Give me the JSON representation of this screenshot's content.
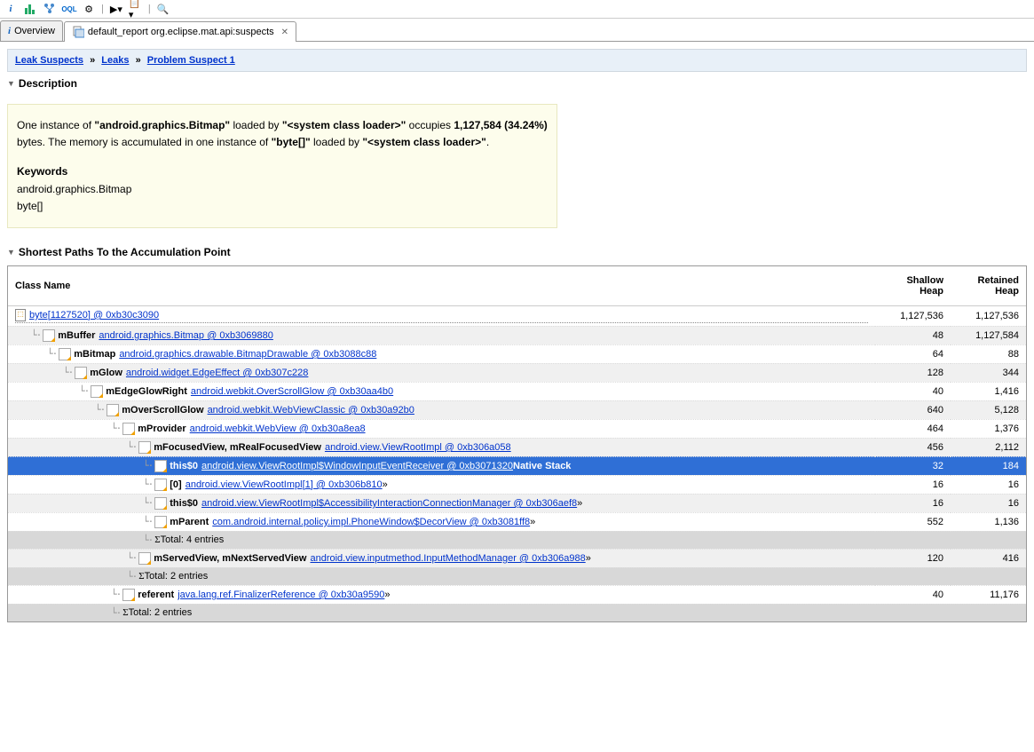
{
  "tabs": {
    "overview": "Overview",
    "report": "default_report  org.eclipse.mat.api:suspects"
  },
  "breadcrumb": {
    "a": "Leak Suspects",
    "b": "Leaks",
    "c": "Problem Suspect 1"
  },
  "sections": {
    "desc_title": "Description",
    "paths_title": "Shortest Paths To the Accumulation Point"
  },
  "desc": {
    "p1a": "One instance of ",
    "p1b": "\"android.graphics.Bitmap\"",
    "p1c": " loaded by ",
    "p1d": "\"<system class loader>\"",
    "p2a": "occupies ",
    "p2b": "1,127,584 (34.24%)",
    "p2c": " bytes. The memory is accumulated in one instance of ",
    "p3a": "\"byte[]\"",
    "p3b": " loaded by ",
    "p3c": "\"<system class loader>\"",
    "p3d": ".",
    "kw_title": "Keywords",
    "kw1": "android.graphics.Bitmap",
    "kw2": "byte[]"
  },
  "table": {
    "h_class": "Class Name",
    "h_shallow": "Shallow Heap",
    "h_retained": "Retained Heap"
  },
  "rows": {
    "r0": {
      "depth": 0,
      "field": "",
      "link": "byte[1127520] @ 0xb30c3090",
      "tail": "",
      "shallow": "1,127,536",
      "retained": "1,127,536",
      "root": true
    },
    "r1": {
      "depth": 1,
      "field": "mBuffer",
      "link": "android.graphics.Bitmap @ 0xb3069880",
      "tail": "",
      "shallow": "48",
      "retained": "1,127,584"
    },
    "r2": {
      "depth": 2,
      "field": "mBitmap",
      "link": "android.graphics.drawable.BitmapDrawable @ 0xb3088c88",
      "tail": "",
      "shallow": "64",
      "retained": "88"
    },
    "r3": {
      "depth": 3,
      "field": "mGlow",
      "link": "android.widget.EdgeEffect @ 0xb307c228",
      "tail": "",
      "shallow": "128",
      "retained": "344"
    },
    "r4": {
      "depth": 4,
      "field": "mEdgeGlowRight",
      "link": "android.webkit.OverScrollGlow @ 0xb30aa4b0",
      "tail": "",
      "shallow": "40",
      "retained": "1,416"
    },
    "r5": {
      "depth": 5,
      "field": "mOverScrollGlow",
      "link": "android.webkit.WebViewClassic @ 0xb30a92b0",
      "tail": "",
      "shallow": "640",
      "retained": "5,128"
    },
    "r6": {
      "depth": 6,
      "field": "mProvider",
      "link": "android.webkit.WebView @ 0xb30a8ea8",
      "tail": "",
      "shallow": "464",
      "retained": "1,376"
    },
    "r7": {
      "depth": 7,
      "field": "mFocusedView, mRealFocusedView",
      "link": "android.view.ViewRootImpl @ 0xb306a058",
      "tail": "",
      "shallow": "456",
      "retained": "2,112"
    },
    "r8": {
      "depth": 8,
      "field": "this$0",
      "link": "android.view.ViewRootImpl$WindowInputEventReceiver @ 0xb3071320",
      "tail": " Native Stack",
      "shallow": "32",
      "retained": "184",
      "selected": true
    },
    "r9": {
      "depth": 8,
      "field": "[0]",
      "link": "android.view.ViewRootImpl[1] @ 0xb306b810",
      "tail": " »",
      "shallow": "16",
      "retained": "16"
    },
    "r10": {
      "depth": 8,
      "field": "this$0",
      "link": "android.view.ViewRootImpl$AccessibilityInteractionConnectionManager @ 0xb306aef8",
      "tail": " »",
      "shallow": "16",
      "retained": "16"
    },
    "r11": {
      "depth": 8,
      "field": "mParent",
      "link": "com.android.internal.policy.impl.PhoneWindow$DecorView @ 0xb3081ff8",
      "tail": " »",
      "shallow": "552",
      "retained": "1,136"
    },
    "r12": {
      "depth": 8,
      "total": true,
      "text": "Total: 4 entries"
    },
    "r13": {
      "depth": 7,
      "field": "mServedView, mNextServedView",
      "link": "android.view.inputmethod.InputMethodManager @ 0xb306a988",
      "tail": " »",
      "shallow": "120",
      "retained": "416"
    },
    "r14": {
      "depth": 7,
      "total": true,
      "text": "Total: 2 entries"
    },
    "r15": {
      "depth": 6,
      "field": "referent",
      "link": "java.lang.ref.FinalizerReference @ 0xb30a9590",
      "tail": " »",
      "shallow": "40",
      "retained": "11,176"
    },
    "r16": {
      "depth": 6,
      "total": true,
      "text": "Total: 2 entries"
    }
  }
}
